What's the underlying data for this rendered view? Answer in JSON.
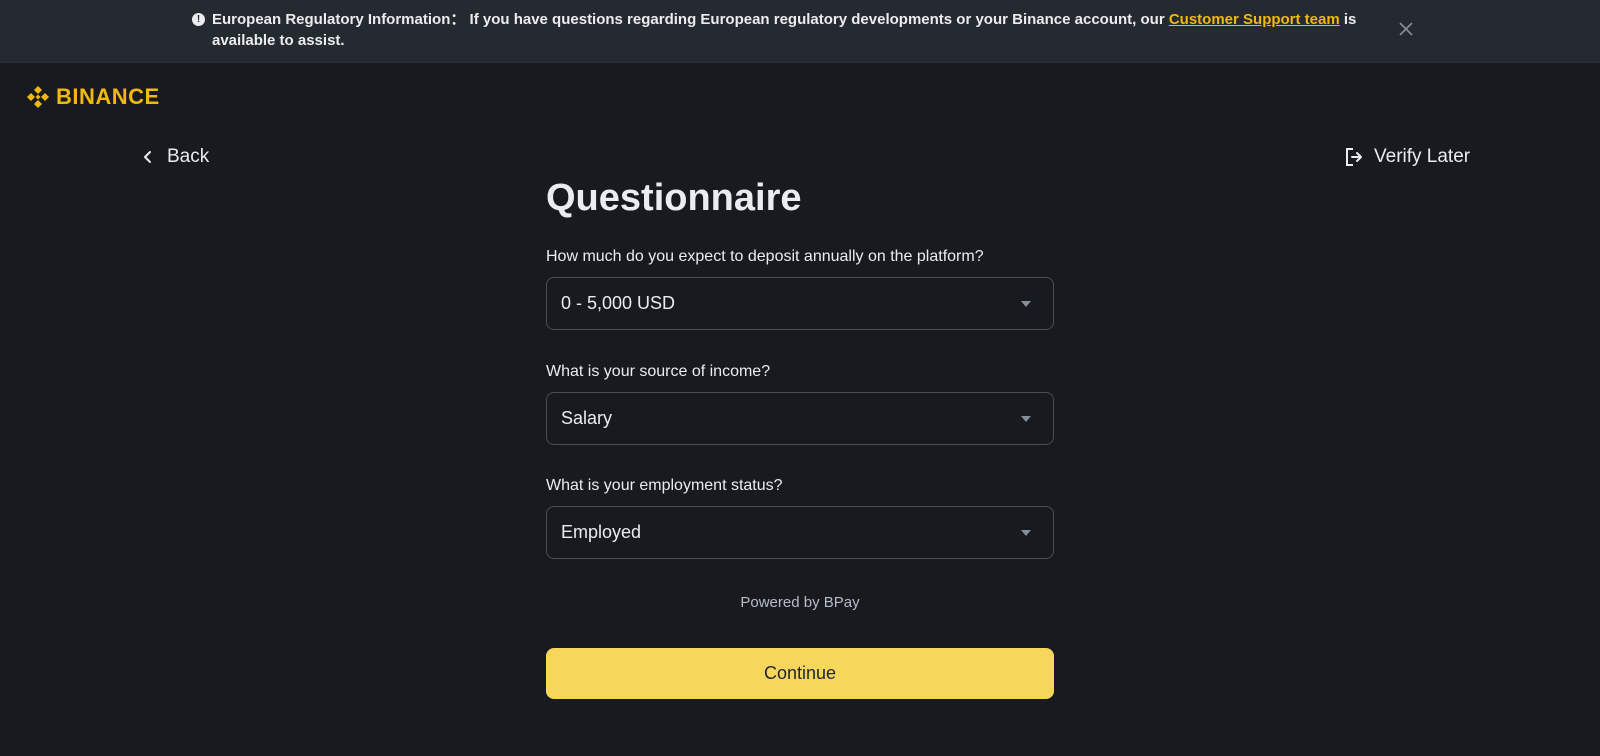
{
  "banner": {
    "icon": "exclamation-circle-icon",
    "title": "European Regulatory Information：",
    "text_before_link": "If you have questions regarding European regulatory developments or your Binance account, our",
    "link_text": "Customer Support team",
    "text_after_link": "is available to assist.",
    "close_icon": "close-icon"
  },
  "header": {
    "logo_text": "BINANCE",
    "logo_icon": "binance-diamond-icon"
  },
  "nav": {
    "back_label": "Back",
    "back_icon": "chevron-left-icon",
    "verify_later_label": "Verify Later",
    "verify_later_icon": "logout-icon"
  },
  "form": {
    "title": "Questionnaire",
    "questions": [
      {
        "label": "How much do you expect to deposit annually on the platform?",
        "value": "0 - 5,000 USD"
      },
      {
        "label": "What is your source of income?",
        "value": "Salary"
      },
      {
        "label": "What is your employment status?",
        "value": "Employed"
      }
    ],
    "powered_by": "Powered by BPay",
    "continue_label": "Continue"
  },
  "colors": {
    "background": "#181A20",
    "banner_background": "#252930",
    "accent": "#F0B90B",
    "button": "#F7D75B",
    "text": "#EAECEF"
  }
}
